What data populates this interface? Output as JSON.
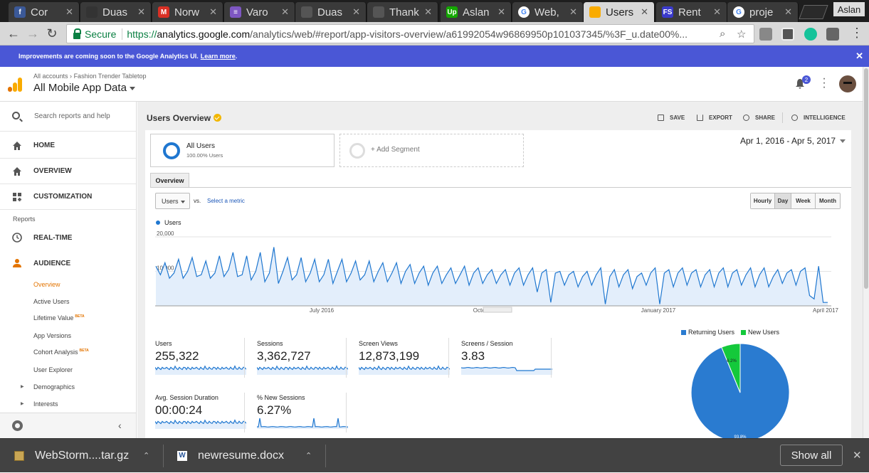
{
  "browser": {
    "tabs": [
      {
        "title": "Cor",
        "favicon": "facebook-icon",
        "color": "#3b5998",
        "glyph": "f",
        "active": false
      },
      {
        "title": "Duas",
        "favicon": "github-icon",
        "color": "#333333",
        "glyph": "",
        "active": false
      },
      {
        "title": "Norw",
        "favicon": "gmail-icon",
        "color": "#d93025",
        "glyph": "M",
        "active": false
      },
      {
        "title": "Varo",
        "favicon": "docs-icon",
        "color": "#7e57c2",
        "glyph": "≡",
        "active": false
      },
      {
        "title": "Duas",
        "favicon": "page-icon",
        "color": "#555555",
        "glyph": "",
        "active": false
      },
      {
        "title": "Thank",
        "favicon": "page-icon",
        "color": "#555555",
        "glyph": "",
        "active": false
      },
      {
        "title": "Aslan",
        "favicon": "upwork-icon",
        "color": "#14a800",
        "glyph": "Up",
        "active": false
      },
      {
        "title": "Web,",
        "favicon": "google-icon",
        "color": "#ffffff",
        "glyph": "G",
        "active": false
      },
      {
        "title": "Users",
        "favicon": "analytics-icon",
        "color": "#f9ab00",
        "glyph": "",
        "active": true
      },
      {
        "title": "Rent",
        "favicon": "fs-icon",
        "color": "#3a3acb",
        "glyph": "FS",
        "active": false
      },
      {
        "title": "proje",
        "favicon": "google-icon",
        "color": "#ffffff",
        "glyph": "G",
        "active": false
      }
    ],
    "profile": "Aslan",
    "secure_label": "Secure",
    "url_scheme": "https://",
    "url_host": "analytics.google.com",
    "url_path": "/analytics/web/#report/app-visitors-overview/a61992054w96869950p101037345/%3F_u.date00%..."
  },
  "banner": {
    "text": "Improvements are coming soon to the Google Analytics UI.",
    "link": "Learn more",
    "after": ".",
    "close": "✕"
  },
  "header": {
    "crumb_accounts": "All accounts",
    "crumb_sep": "›",
    "crumb_account": "Fashion Trender Tabletop",
    "property": "All Mobile App Data",
    "notifications": "2"
  },
  "sidebar": {
    "search_placeholder": "Search reports and help",
    "items": [
      {
        "label": "HOME",
        "icon": "home-icon"
      },
      {
        "label": "OVERVIEW",
        "icon": "home-icon"
      },
      {
        "label": "CUSTOMIZATION",
        "icon": "dashboard-icon"
      }
    ],
    "reports_label": "Reports",
    "reports": [
      {
        "label": "REAL-TIME",
        "icon": "clock-icon"
      },
      {
        "label": "AUDIENCE",
        "icon": "person-icon"
      }
    ],
    "audience_sub": [
      {
        "label": "Overview",
        "active": true,
        "beta": ""
      },
      {
        "label": "Active Users",
        "active": false,
        "beta": ""
      },
      {
        "label": "Lifetime Value",
        "active": false,
        "beta": "BETA"
      },
      {
        "label": "App Versions",
        "active": false,
        "beta": ""
      },
      {
        "label": "Cohort Analysis",
        "active": false,
        "beta": "BETA"
      },
      {
        "label": "User Explorer",
        "active": false,
        "beta": ""
      },
      {
        "label": "Demographics",
        "active": false,
        "beta": "",
        "expandable": true
      },
      {
        "label": "Interests",
        "active": false,
        "beta": "",
        "expandable": true
      }
    ]
  },
  "report": {
    "title": "Users Overview",
    "actions": {
      "save": "SAVE",
      "export": "EXPORT",
      "share": "SHARE",
      "intelligence": "INTELLIGENCE"
    },
    "segment_title": "All Users",
    "segment_sub": "100.00% Users",
    "add_segment": "+ Add Segment",
    "date_range": "Apr 1, 2016 - Apr 5, 2017",
    "tab": "Overview",
    "metric": "Users",
    "vs": "vs.",
    "select_metric": "Select a metric",
    "granularity": [
      {
        "label": "Hourly",
        "selected": false
      },
      {
        "label": "Day",
        "selected": true
      },
      {
        "label": "Week",
        "selected": false
      },
      {
        "label": "Month",
        "selected": false
      }
    ],
    "legend": "Users"
  },
  "chart_data": [
    {
      "type": "line",
      "title": "",
      "series": [
        {
          "name": "Users",
          "values": [
            11500,
            9000,
            12500,
            8000,
            9500,
            13500,
            8000,
            10000,
            14000,
            8500,
            9000,
            13000,
            8000,
            9500,
            14500,
            8500,
            10500,
            15500,
            8500,
            9000,
            14500,
            7500,
            10000,
            15500,
            7000,
            9500,
            17000,
            6500,
            10000,
            14000,
            7500,
            9000,
            14000,
            7000,
            9500,
            13500,
            7000,
            9000,
            13500,
            6500,
            10000,
            13500,
            7000,
            9500,
            13000,
            7500,
            9000,
            13000,
            7000,
            10000,
            12500,
            7000,
            9500,
            12500,
            6500,
            10000,
            12000,
            6500,
            9500,
            11500,
            6000,
            9500,
            11500,
            6500,
            9000,
            11000,
            6500,
            9000,
            11500,
            6000,
            9500,
            11000,
            6500,
            9000,
            10500,
            6500,
            9000,
            10500,
            6000,
            9500,
            11000,
            6000,
            9000,
            11000,
            4000,
            9500,
            10500,
            1000,
            9500,
            10000,
            6000,
            9000,
            10000,
            5500,
            8500,
            10000,
            6000,
            9000,
            11000,
            500,
            8500,
            10500,
            5500,
            9000,
            10500,
            5000,
            8500,
            9500,
            6000,
            9500,
            11000,
            500,
            9500,
            10500,
            5500,
            9500,
            11000,
            6000,
            9500,
            10500,
            5500,
            9000,
            10500,
            5500,
            9500,
            11000,
            5500,
            9500,
            10500,
            6000,
            9000,
            11000,
            5500,
            9000,
            11000,
            5500,
            8500,
            10500,
            6500,
            9500,
            10500,
            6000,
            10000,
            11000,
            3000,
            2000,
            11500,
            1000,
            1000
          ]
        }
      ],
      "x_ticks": [
        "July 2016",
        "October 2016",
        "January 2017",
        "April 2017"
      ],
      "y_ticks": [
        "10,000",
        "20,000"
      ],
      "ylim": [
        0,
        20000
      ],
      "grid": true
    },
    {
      "type": "pie",
      "categories": [
        "Returning Users",
        "New Users"
      ],
      "values": [
        93.8,
        6.2
      ],
      "labels": [
        "93.8%",
        "6.2%"
      ],
      "colors": [
        "#2a7bd0",
        "#14c93b"
      ],
      "legend_position": "top"
    }
  ],
  "stats": [
    {
      "label": "Users",
      "value": "255,322",
      "spark": "flat"
    },
    {
      "label": "Sessions",
      "value": "3,362,727",
      "spark": "flat"
    },
    {
      "label": "Screen Views",
      "value": "12,873,199",
      "spark": "flat"
    },
    {
      "label": "Screens / Session",
      "value": "3.83",
      "spark": "dip"
    },
    {
      "label": "Avg. Session Duration",
      "value": "00:00:24",
      "spark": "flat"
    },
    {
      "label": "% New Sessions",
      "value": "6.27%",
      "spark": "spikes"
    }
  ],
  "downloads": [
    {
      "name": "WebStorm....tar.gz",
      "icon": "archive-icon"
    },
    {
      "name": "newresume.docx",
      "icon": "word-icon"
    }
  ],
  "show_all": "Show all",
  "colors": {
    "accent": "#1f77d0",
    "banner": "#4a57d6",
    "new_users": "#14c93b",
    "returning_users": "#2a7bd0"
  }
}
